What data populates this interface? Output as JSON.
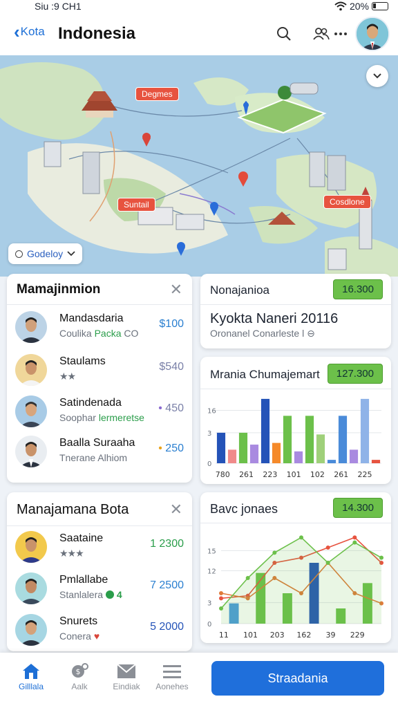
{
  "status": {
    "time": "Siu :9 CH1",
    "battery": "20%"
  },
  "header": {
    "back_label": "Kota",
    "title": "Indonesia"
  },
  "map": {
    "labels": [
      "Degmes",
      "Suntail",
      "Cosdlone"
    ],
    "filter_label": "Godeloy"
  },
  "management_card": {
    "title": "Mamajinmion",
    "rows": [
      {
        "name": "Mandasdaria",
        "sub": "Coulika",
        "sub_tag": "Packa",
        "sub_tail": "CO",
        "value": "100",
        "value_prefix": "$"
      },
      {
        "name": "Staulams",
        "stars": "★★",
        "value": "540",
        "value_prefix": "$"
      },
      {
        "name": "Satindenada",
        "sub": "Soophar",
        "sub_tag": "lermeretse",
        "value": "450",
        "value_prefix": "•"
      },
      {
        "name": "Baalla Suraaha",
        "sub": "Tnerane Alhiom",
        "value": "250",
        "value_prefix": "•"
      }
    ]
  },
  "team_card": {
    "title": "Manajamana Bota",
    "rows": [
      {
        "name": "Saataine",
        "stars": "★★★",
        "value": "1 2300"
      },
      {
        "name": "Pmlallabe",
        "sub": "Stanlalera",
        "badge": "4",
        "value": "7 2500"
      },
      {
        "name": "Snurets",
        "sub": "Conera",
        "value": "5 2000"
      }
    ]
  },
  "summary_card": {
    "title": "Nonajanioa",
    "value": "16.300",
    "headline": "Kyokta Naneri 20116",
    "sub": "Oronanel Conarleste l"
  },
  "bar_card": {
    "title": "Mrania Chumajemart",
    "value": "127.300"
  },
  "line_card": {
    "title": "Bavc jonaes",
    "value": "14.300"
  },
  "chart_data": [
    {
      "type": "bar",
      "title": "Mrania Chumajemart",
      "yticks": [
        "16",
        "3",
        "0"
      ],
      "xticks": [
        "780",
        "261",
        "223",
        "101",
        "102",
        "261",
        "225"
      ],
      "ylim": [
        0,
        20
      ],
      "values": [
        9,
        4,
        9,
        5.5,
        19,
        6,
        14,
        3.5,
        14,
        8.5,
        1,
        14,
        4,
        19,
        1
      ],
      "colors": [
        "#2453b8",
        "#f08a8a",
        "#6cc04a",
        "#a98ae0",
        "#2453b8",
        "#f58a2a",
        "#6cc04a",
        "#a98ae0",
        "#6cc04a",
        "#9fd07a",
        "#4a8bd9",
        "#4a8bd9",
        "#a98ae0",
        "#8fb3e8",
        "#e7533f"
      ],
      "grid": true
    },
    {
      "type": "line",
      "title": "Bavc jonaes",
      "yticks": [
        "15",
        "12",
        "3",
        "0"
      ],
      "xticks": [
        "11",
        "101",
        "203",
        "162",
        "39",
        "229"
      ],
      "ylim": [
        0,
        18
      ],
      "bar_values": [
        4,
        10,
        6,
        12,
        3,
        8
      ],
      "bar_colors": [
        "#4a9be0",
        "#6cc04a",
        "#6cc04a",
        "#2453b8",
        "#6cc04a",
        "#6cc04a"
      ],
      "series": [
        {
          "values": [
            5,
            5.5,
            12,
            13,
            15,
            17,
            12
          ],
          "color": "#e7533f"
        },
        {
          "values": [
            6,
            5,
            9,
            6,
            12,
            6,
            4
          ],
          "color": "#e07a3a"
        },
        {
          "values": [
            3,
            9,
            14,
            17,
            12,
            16,
            13
          ],
          "color": "#6cc04a"
        }
      ],
      "grid": true
    }
  ],
  "bottom_nav": {
    "items": [
      {
        "label": "Gilllala",
        "icon": "home-icon"
      },
      {
        "label": "Aalk",
        "icon": "search-money-icon"
      },
      {
        "label": "Eindiak",
        "icon": "mail-icon"
      },
      {
        "label": "Aonehes",
        "icon": "menu-icon"
      }
    ],
    "cta": "Straadania"
  }
}
